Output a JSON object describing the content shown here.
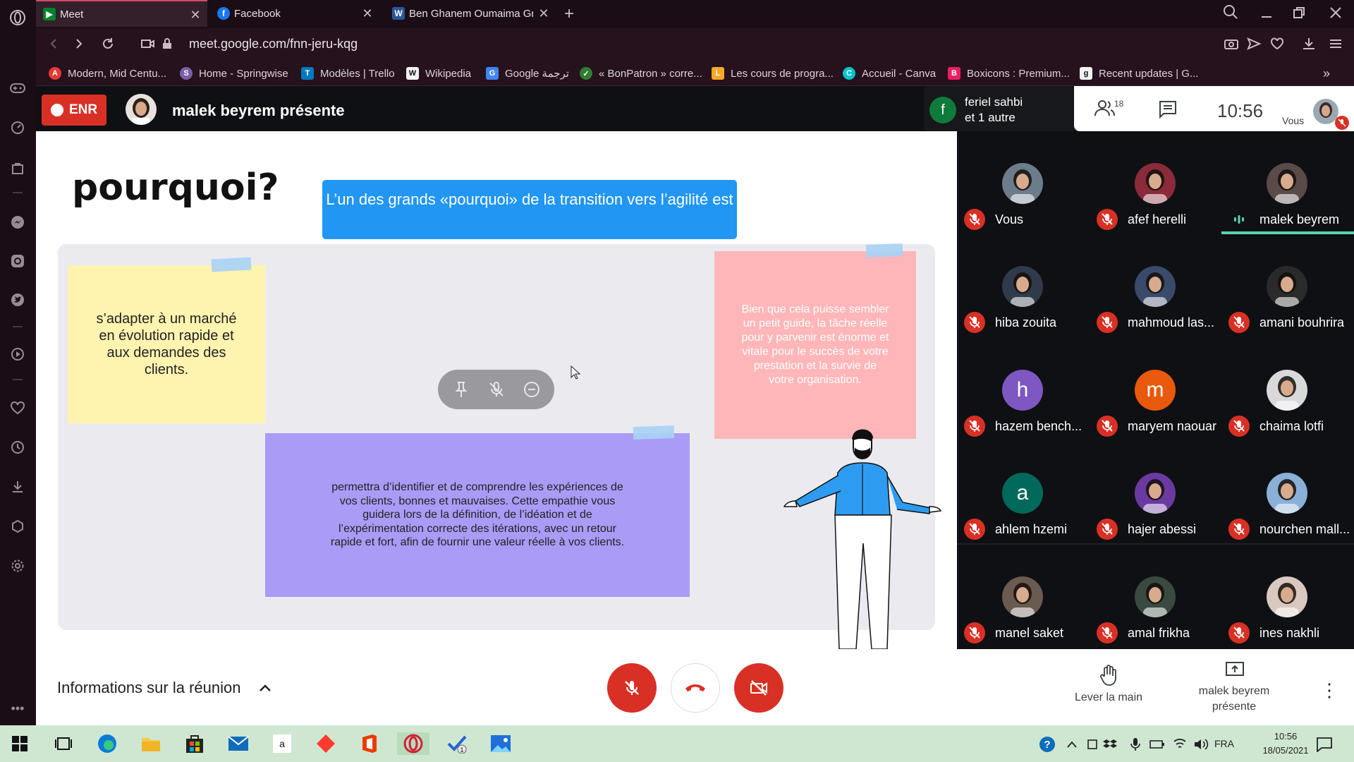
{
  "browser": {
    "tabs": [
      {
        "title": "Meet",
        "active": true
      },
      {
        "title": "Facebook",
        "active": false
      },
      {
        "title": "Ben Ghanem Oumaima Gr",
        "active": false
      }
    ],
    "new_tab_symbol": "+",
    "url": "meet.google.com/fnn-jeru-kqg",
    "bookmarks": [
      {
        "label": "Modern, Mid Centu...",
        "icon": "A"
      },
      {
        "label": "Home - Springwise",
        "icon": "S"
      },
      {
        "label": "Modèles | Trello",
        "icon": "T"
      },
      {
        "label": "Wikipedia",
        "icon": "W"
      },
      {
        "label": "Google ترجمة",
        "icon": "G"
      },
      {
        "label": "« BonPatron » corre...",
        "icon": "✓"
      },
      {
        "label": "Les cours de progra...",
        "icon": "L"
      },
      {
        "label": "Accueil - Canva",
        "icon": "C"
      },
      {
        "label": "Boxicons : Premium...",
        "icon": "B"
      },
      {
        "label": "Recent updates | G...",
        "icon": "g"
      }
    ],
    "more_bookmarks": "»"
  },
  "meet": {
    "recording_badge": "ENR",
    "presenter_title": "malek beyrem présente",
    "speaking": {
      "initial": "f",
      "line1": "feriel sahbi",
      "line2": "et 1 autre"
    },
    "people_count": "18",
    "clock": "10:56",
    "self_label": "Vous",
    "meeting_info": "Informations sur la réunion",
    "raise_hand": "Lever la main",
    "present_now": "malek beyrem présente"
  },
  "slide": {
    "title": "pourquoi?",
    "banner": "L’un des grands «pourquoi» de la transition vers l’agilité est",
    "yellow_note": "s’adapter à un marché en évolution rapide et aux demandes des clients.",
    "pink_note": "Bien que cela puisse sembler un petit guide, la tâche réelle pour y parvenir est énorme et vitale pour le succès de votre prestation et la survie de votre organisation.",
    "purple_note": "permettra d’identifier et de comprendre les expériences de vos clients, bonnes et mauvaises. Cette empathie vous guidera lors de la définition, de l’idéation et de l’expérimentation correcte des itérations, avec un retour rapide et fort, afin de fournir une valeur réelle à vos clients."
  },
  "participants": [
    {
      "name": "Vous",
      "initial": "",
      "color": "#6b7d8c"
    },
    {
      "name": "afef herelli",
      "initial": "",
      "color": "#8a2a3a"
    },
    {
      "name": "malek beyrem",
      "initial": "",
      "color": "#5a4a4a"
    },
    {
      "name": "hiba zouita",
      "initial": "",
      "color": "#2f3a4a"
    },
    {
      "name": "mahmoud las...",
      "initial": "",
      "color": "#3a4a6a"
    },
    {
      "name": "amani bouhrira",
      "initial": "",
      "color": "#2a2a2a"
    },
    {
      "name": "hazem bench...",
      "initial": "h",
      "color": "#7e57c2"
    },
    {
      "name": "maryem naouar",
      "initial": "m",
      "color": "#e8590c"
    },
    {
      "name": "chaima lotfi",
      "initial": "",
      "color": "#d9d9d9"
    },
    {
      "name": "ahlem hzemi",
      "initial": "a",
      "color": "#00695c"
    },
    {
      "name": "hajer abessi",
      "initial": "",
      "color": "#6a3aa0"
    },
    {
      "name": "nourchen mall...",
      "initial": "",
      "color": "#8ab0d8"
    },
    {
      "name": "manel saket",
      "initial": "",
      "color": "#6a5a50"
    },
    {
      "name": "amal frikha",
      "initial": "",
      "color": "#3a4a40"
    },
    {
      "name": "ines nakhli",
      "initial": "",
      "color": "#d8c8c0"
    }
  ],
  "taskbar": {
    "lang": "FRA",
    "time": "10:56",
    "date": "18/05/2021"
  },
  "colors": {
    "meet_red": "#d93025",
    "banner_blue": "#2196f3",
    "active_speaker": "#5bd1b6"
  }
}
